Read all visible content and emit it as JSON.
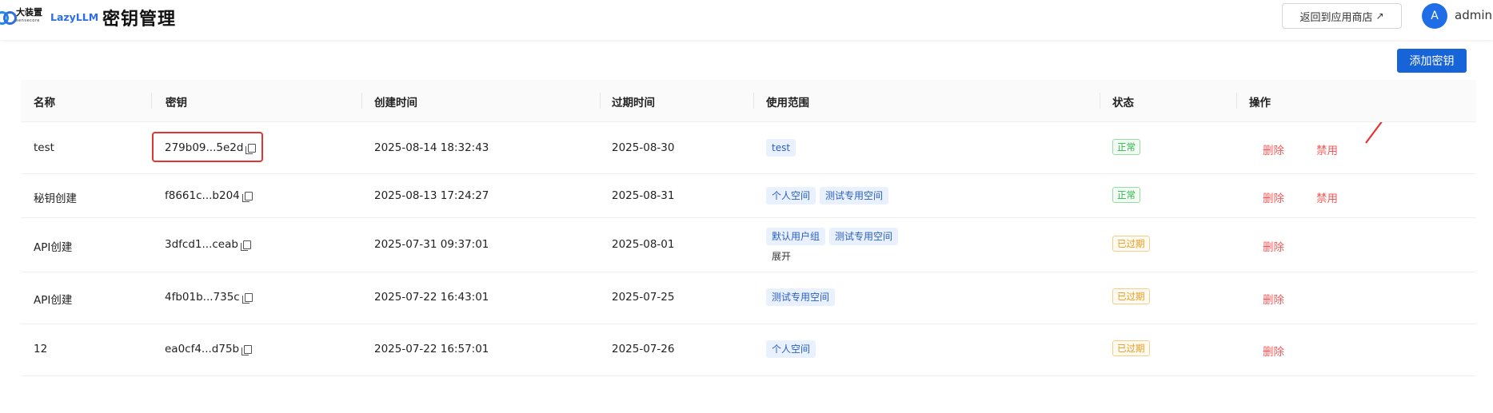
{
  "header": {
    "logo_cn": "大装置",
    "logo_sub": "sensecore",
    "logo_en": "LazyLLM",
    "title": "密钥管理",
    "store_button": "返回到应用商店",
    "store_arrow": "↗",
    "avatar_letter": "A",
    "username": "admin"
  },
  "toolbar": {
    "add_button": "添加密钥"
  },
  "colors": {
    "primary": "#1763d8",
    "danger": "#f05a5a",
    "annotation": "#e3342f"
  },
  "table": {
    "columns": [
      "名称",
      "密钥",
      "创建时间",
      "过期时间",
      "使用范围",
      "状态",
      "操作"
    ],
    "rows": [
      {
        "name": "test",
        "key": "279b09...5e2d",
        "created": "2025-08-14 18:32:43",
        "expires": "2025-08-30",
        "scopes": [
          "test"
        ],
        "expand": "",
        "status": "正常",
        "status_type": "ok",
        "delete": "删除",
        "disable": "禁用"
      },
      {
        "name": "秘钥创建",
        "key": "f8661c...b204",
        "created": "2025-08-13 17:24:27",
        "expires": "2025-08-31",
        "scopes": [
          "个人空间",
          "测试专用空间"
        ],
        "expand": "",
        "status": "正常",
        "status_type": "ok",
        "delete": "删除",
        "disable": "禁用"
      },
      {
        "name": "API创建",
        "key": "3dfcd1...ceab",
        "created": "2025-07-31 09:37:01",
        "expires": "2025-08-01",
        "scopes": [
          "默认用户组",
          "测试专用空间"
        ],
        "expand": "展开",
        "status": "已过期",
        "status_type": "expired",
        "delete": "删除",
        "disable": ""
      },
      {
        "name": "API创建",
        "key": "4fb01b...735c",
        "created": "2025-07-22 16:43:01",
        "expires": "2025-07-25",
        "scopes": [
          "测试专用空间"
        ],
        "expand": "",
        "status": "已过期",
        "status_type": "expired",
        "delete": "删除",
        "disable": ""
      },
      {
        "name": "12",
        "key": "ea0cf4...d75b",
        "created": "2025-07-22 16:57:01",
        "expires": "2025-07-26",
        "scopes": [
          "个人空间"
        ],
        "expand": "",
        "status": "已过期",
        "status_type": "expired",
        "delete": "删除",
        "disable": ""
      }
    ]
  }
}
